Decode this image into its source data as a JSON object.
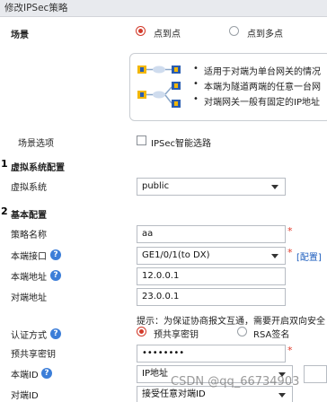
{
  "title": "修改IPSec策略",
  "scenario": {
    "label": "场景",
    "options": [
      "点到点",
      "点到多点"
    ],
    "selected": 0,
    "desc": [
      "适用于对端为单台网关的情况",
      "本端为隧道两端的任意一台网",
      "对端网关一般有固定的IP地址"
    ]
  },
  "scenario_option": {
    "label": "场景选项",
    "checkbox_label": "IPSec智能选路",
    "checked": false
  },
  "section1": {
    "number": "1",
    "title": "虚拟系统配置"
  },
  "vsys": {
    "label": "虚拟系统",
    "value": "public"
  },
  "section2": {
    "number": "2",
    "title": "基本配置"
  },
  "policy_name": {
    "label": "策略名称",
    "value": "aa",
    "required": "*"
  },
  "local_interface": {
    "label": "本端接口",
    "value": "GE1/0/1(to DX)",
    "required": "*",
    "config_link": "[配置]"
  },
  "local_address": {
    "label": "本端地址",
    "value": "12.0.0.1"
  },
  "peer_address": {
    "label": "对端地址",
    "value": "23.0.0.1"
  },
  "auth": {
    "label": "认证方式",
    "hint": "提示：为保证协商报文互通，需要开启双向安全",
    "options": [
      "预共享密钥",
      "RSA签名"
    ],
    "selected": 0
  },
  "psk": {
    "label": "预共享密钥",
    "value": "••••••••",
    "required": "*"
  },
  "local_id": {
    "label": "本端ID",
    "value": "IP地址"
  },
  "peer_id": {
    "label": "对端ID",
    "value": "接受任意对端ID"
  },
  "help_glyph": "?",
  "watermark": "CSDN @qq_66734903"
}
